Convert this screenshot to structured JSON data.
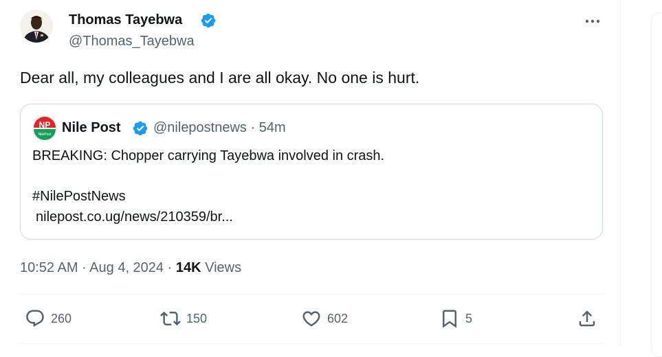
{
  "tweet": {
    "author": {
      "name": "Thomas Tayebwa",
      "handle": "@Thomas_Tayebwa",
      "verified": true
    },
    "text": "Dear all, my colleagues and I are all okay. No one is hurt.",
    "quote": {
      "logo_text": "NP",
      "logo_subtext": "NilePost",
      "name": "Nile Post",
      "meta": "@nilepostnews · 54m",
      "line1": "BREAKING: Chopper carrying Tayebwa involved in crash.",
      "hashtag": "#NilePostNews",
      "link": "nilepost.co.ug/news/210359/br..."
    },
    "timestamp": "10:52 AM · Aug 4, 2024 · ",
    "views_count": "14K",
    "views_label": " Views",
    "actions": {
      "replies": "260",
      "reposts": "150",
      "likes": "602",
      "bookmarks": "5"
    }
  },
  "colors": {
    "text_primary": "#0f1419",
    "text_secondary": "#536471",
    "verified_blue": "#1d9bf0",
    "nilepost_red": "#e0262c",
    "nilepost_green": "#1a9e57",
    "border": "#cfd9de"
  },
  "icons": [
    "verified-icon",
    "more-icon",
    "reply-icon",
    "repost-icon",
    "like-icon",
    "bookmark-icon",
    "share-icon"
  ]
}
